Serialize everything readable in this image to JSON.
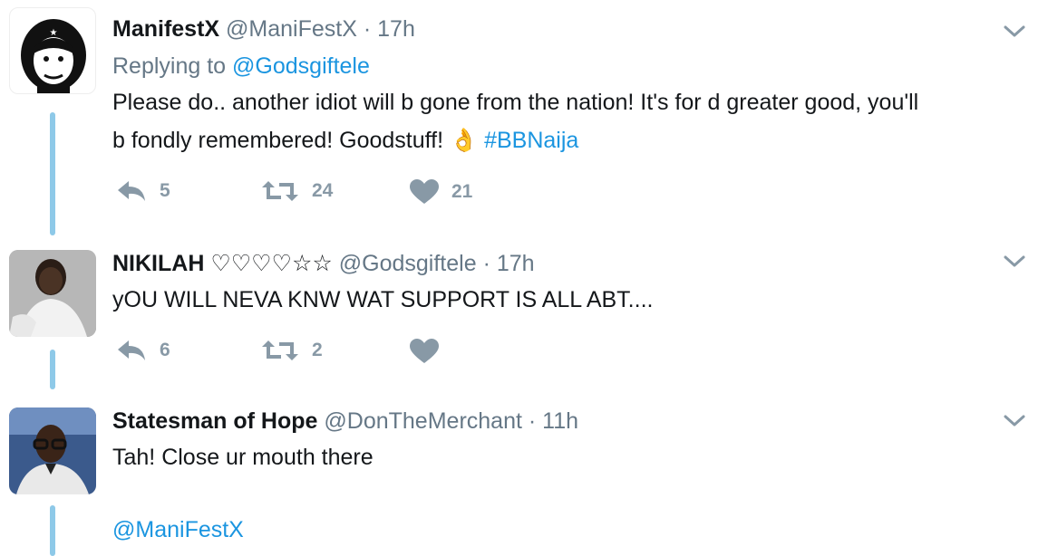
{
  "colors": {
    "link": "#1b95e0",
    "muted": "#657786",
    "icon": "#8899a6",
    "thread": "#8ec9e8"
  },
  "tweets": [
    {
      "name": "ManifestX",
      "handle": "@ManiFestX",
      "dot": "·",
      "time": "17h",
      "reply_prefix": "Replying to",
      "reply_handle": "@Godsgiftele",
      "text_line1": "Please do.. another idiot will b gone from the nation! It's for d greater good, you'll",
      "text_line2_a": "b fondly remembered! Goodstuff!",
      "emoji": "👌",
      "hashtag": "#BBNaija",
      "replies": "5",
      "retweets": "24",
      "likes": "21"
    },
    {
      "name": "NIKILAH ♡♡♡♡☆☆",
      "handle": "@Godsgiftele",
      "dot": "·",
      "time": "17h",
      "text": "yOU WILL NEVA KNW WAT SUPPORT IS ALL ABT....",
      "replies": "6",
      "retweets": "2",
      "likes": ""
    },
    {
      "name": "Statesman of Hope",
      "handle": "@DonTheMerchant",
      "dot": "·",
      "time": "11h",
      "text": "Tah! Close ur mouth there",
      "mention": "@ManiFestX"
    }
  ]
}
